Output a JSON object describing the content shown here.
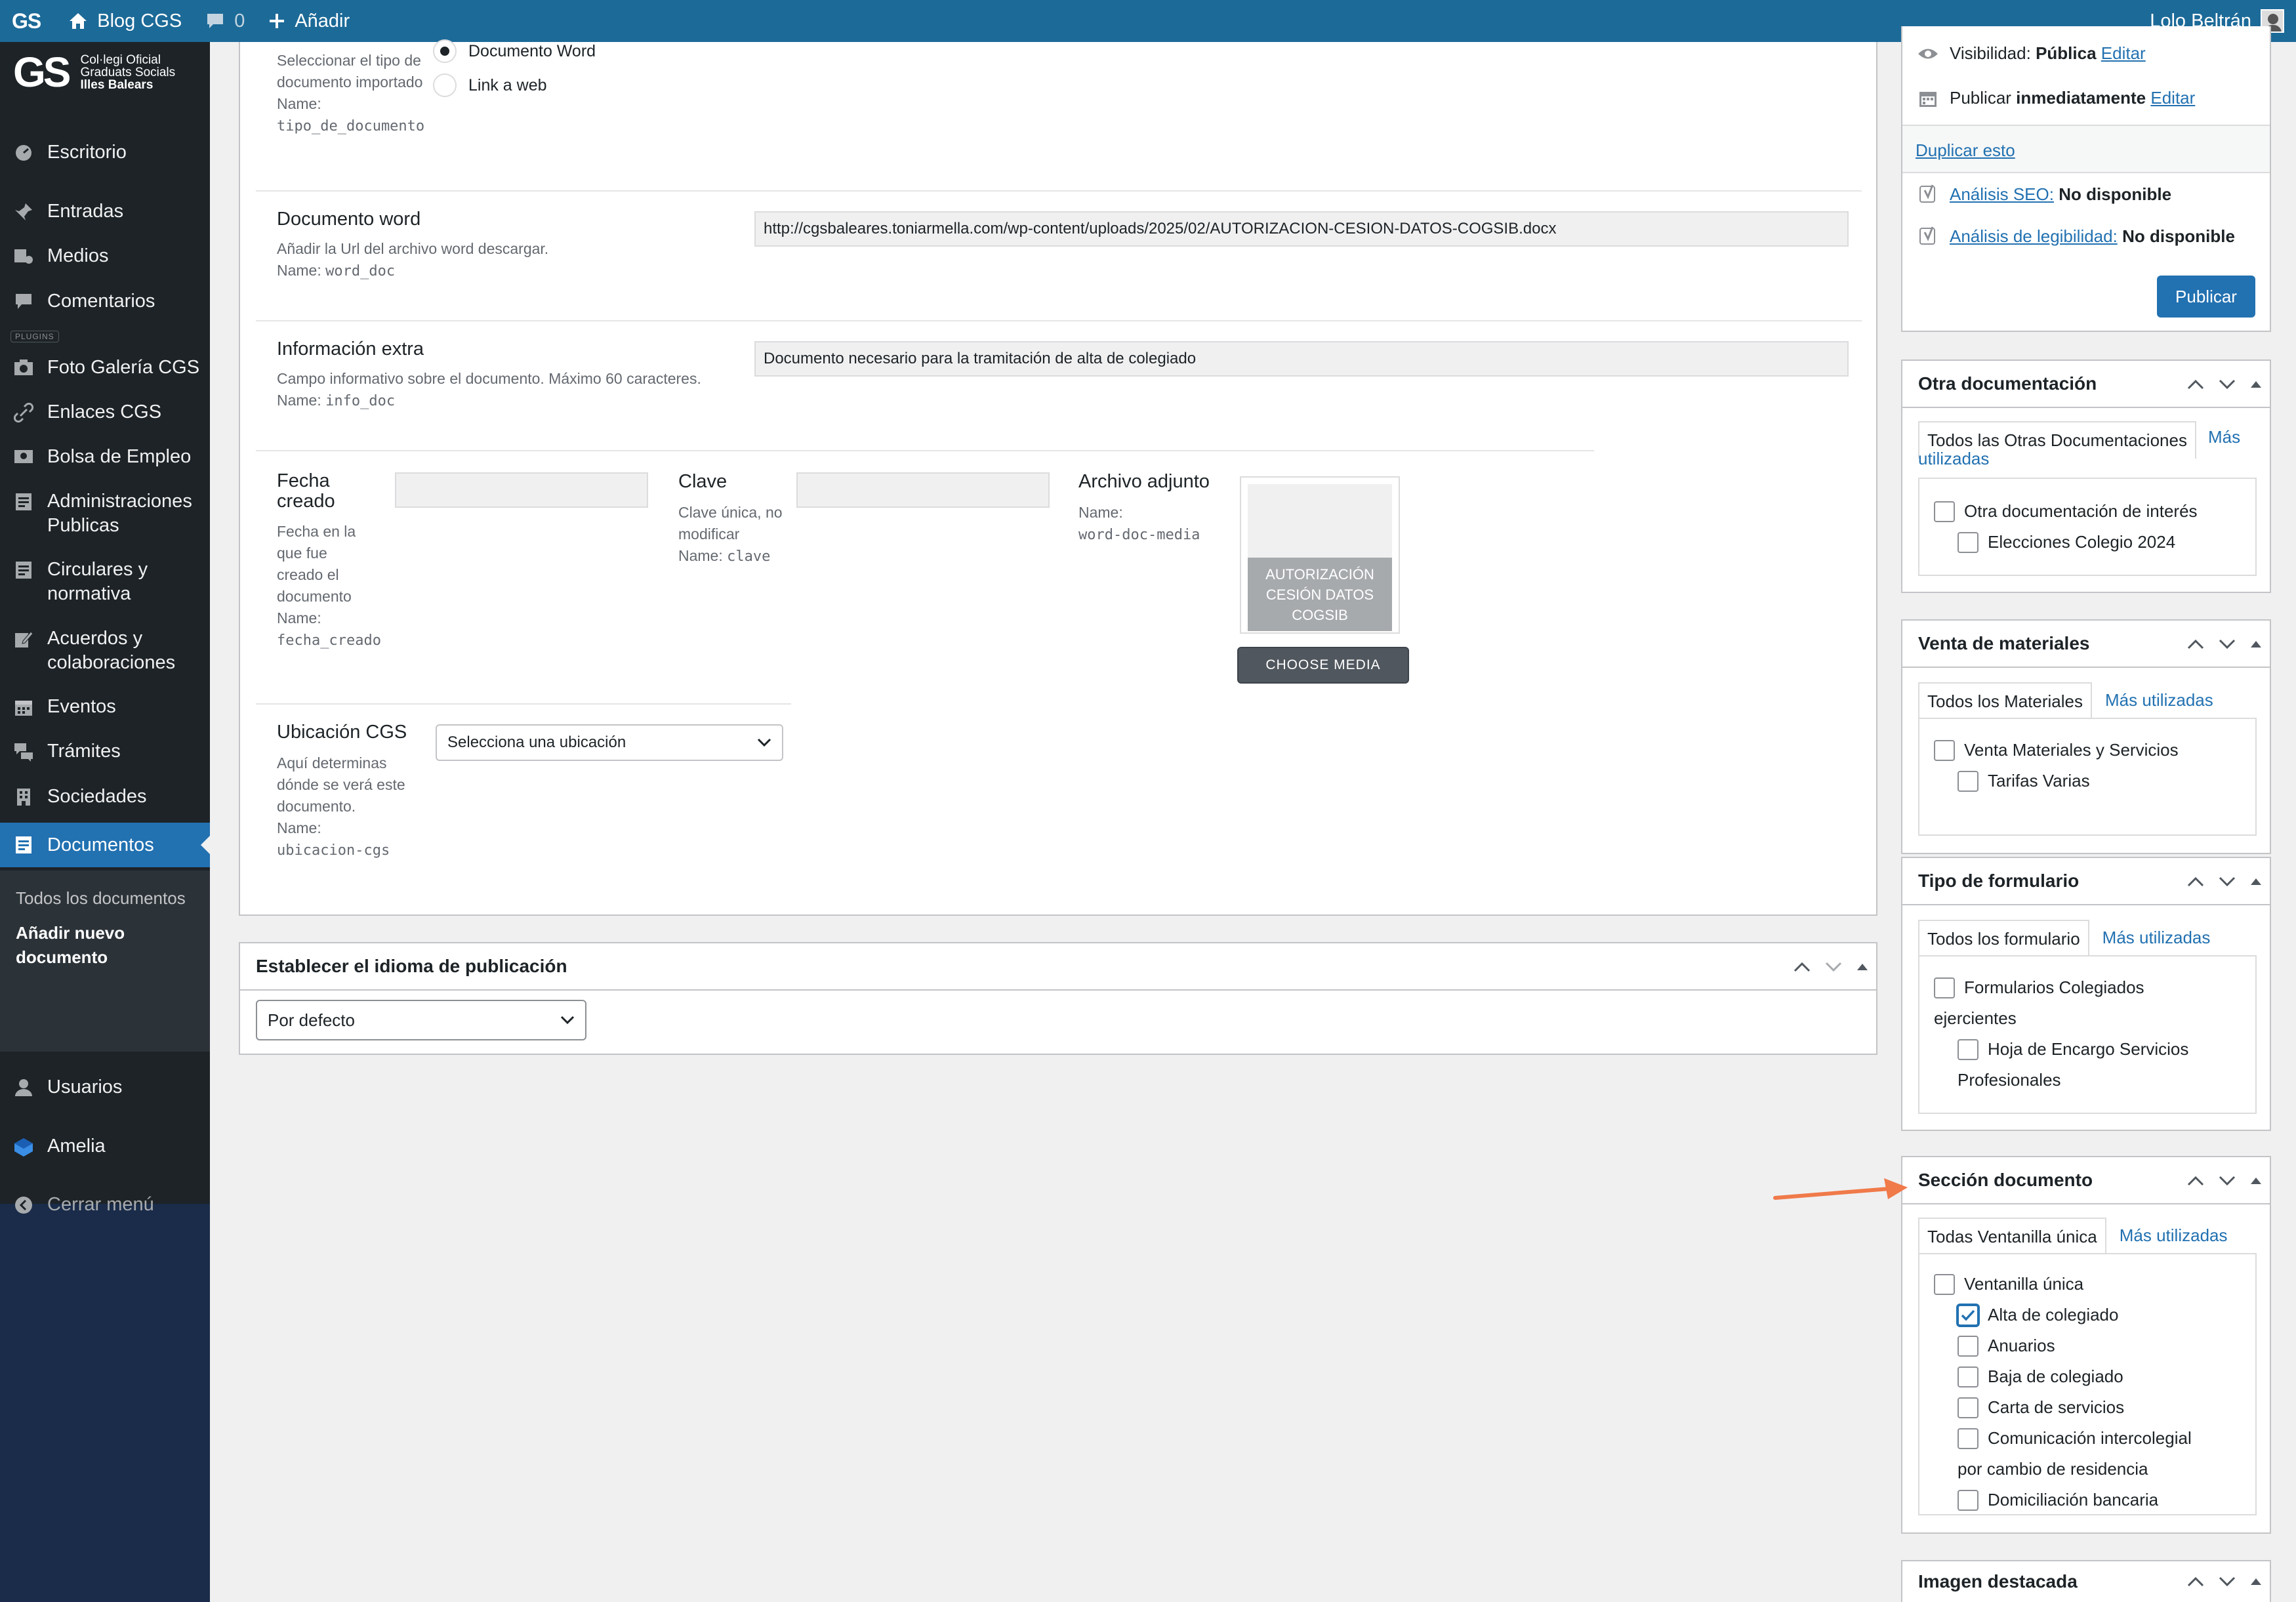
{
  "adminbar": {
    "logo": "GS",
    "site_name": "Blog CGS",
    "comments_count": "0",
    "add_new": "Añadir",
    "user_name": "Lolo Beltrán"
  },
  "brand": {
    "mark": "GS",
    "line1": "Col·legi Oficial",
    "line2": "Graduats Socials",
    "line3": "Illes Balears"
  },
  "sidebar": {
    "plugins_separator": "PLUGINS",
    "items": [
      {
        "label": "Escritorio"
      },
      {
        "label": "Entradas"
      },
      {
        "label": "Medios"
      },
      {
        "label": "Comentarios"
      },
      {
        "label": "Foto Galería CGS"
      },
      {
        "label": "Enlaces CGS"
      },
      {
        "label": "Bolsa de Empleo"
      },
      {
        "label": "Administraciones Publicas"
      },
      {
        "label": "Circulares y normativa"
      },
      {
        "label": "Acuerdos y colaboraciones"
      },
      {
        "label": "Eventos"
      },
      {
        "label": "Trámites"
      },
      {
        "label": "Sociedades"
      },
      {
        "label": "Documentos"
      },
      {
        "label": "Usuarios"
      },
      {
        "label": "Amelia"
      },
      {
        "label": "Cerrar menú"
      }
    ],
    "submenu": [
      {
        "label": "Todos los documentos"
      },
      {
        "label": "Añadir nuevo documento"
      }
    ]
  },
  "acf": {
    "tipo": {
      "desc": "Seleccionar el tipo de documento importado",
      "name_prefix": "Name:",
      "name": "tipo_de_documento",
      "options": [
        "Documento Word",
        "Link a web"
      ],
      "selected": "Documento Word"
    },
    "word_doc": {
      "label": "Documento word",
      "desc": "Añadir la Url del archivo word descargar.",
      "name_prefix": "Name:",
      "name": "word_doc",
      "value": "http://cgsbaleares.toniarmella.com/wp-content/uploads/2025/02/AUTORIZACION-CESION-DATOS-COGSIB.docx"
    },
    "info_doc": {
      "label": "Información extra",
      "desc": "Campo informativo sobre el documento. Máximo 60 caracteres.",
      "name_prefix": "Name:",
      "name": "info_doc",
      "value": "Documento necesario para la tramitación de alta de colegiado"
    },
    "fecha": {
      "label": "Fecha creado",
      "desc": "Fecha en la que fue creado el documento",
      "name_prefix": "Name:",
      "name": "fecha_creado",
      "value": ""
    },
    "clave": {
      "label": "Clave",
      "desc": "Clave única, no modificar",
      "name_prefix": "Name:",
      "name": "clave",
      "value": ""
    },
    "archivo": {
      "label": "Archivo adjunto",
      "name_prefix": "Name:",
      "name": "word-doc-media",
      "thumb_label": "AUTORIZACIÓN CESIÓN DATOS COGSIB",
      "button": "CHOOSE MEDIA"
    },
    "ubicacion": {
      "label": "Ubicación CGS",
      "desc": "Aquí determinas dónde se verá este documento.",
      "name_prefix": "Name:",
      "name": "ubicacion-cgs",
      "selected": "Selecciona una ubicación"
    }
  },
  "language_box": {
    "title": "Establecer el idioma de publicación",
    "selected": "Por defecto"
  },
  "publish": {
    "visibility_label": "Visibilidad:",
    "visibility_value": "Pública",
    "visibility_edit": "Editar",
    "publish_label": "Publicar",
    "publish_value": "inmediatamente",
    "publish_edit": "Editar",
    "duplicate": "Duplicar esto",
    "seo_label": "Análisis SEO:",
    "seo_value": "No disponible",
    "readability_label": "Análisis de legibilidad:",
    "readability_value": "No disponible",
    "button": "Publicar"
  },
  "otra_doc": {
    "title": "Otra documentación",
    "tab_all": "Todos las Otras Documentaciones",
    "tab_used_1": "Más",
    "tab_used_2": "utilizadas",
    "items": [
      {
        "label": "Otra documentación de interés",
        "checked": false
      },
      {
        "label": "Elecciones Colegio 2024",
        "checked": false
      }
    ]
  },
  "venta": {
    "title": "Venta de materiales",
    "tab_all": "Todos los Materiales",
    "tab_used": "Más utilizadas",
    "items": [
      {
        "label": "Venta Materiales y Servicios",
        "checked": false
      },
      {
        "label": "Tarifas Varias",
        "checked": false
      }
    ]
  },
  "tipo_form": {
    "title": "Tipo de formulario",
    "tab_all": "Todos los formulario",
    "tab_used": "Más utilizadas",
    "items": [
      {
        "label_1": "Formularios Colegiados",
        "label_2": "ejercientes",
        "checked": false
      },
      {
        "label_1": "Hoja de Encargo Servicios",
        "label_2": "Profesionales",
        "checked": false
      }
    ]
  },
  "seccion": {
    "title": "Sección documento",
    "tab_all": "Todas Ventanilla única",
    "tab_used": "Más utilizadas",
    "items": [
      {
        "label": "Ventanilla única",
        "checked": false
      },
      {
        "label": "Alta de colegiado",
        "checked": true
      },
      {
        "label": "Anuarios",
        "checked": false
      },
      {
        "label": "Baja de colegiado",
        "checked": false
      },
      {
        "label": "Carta de servicios",
        "checked": false
      },
      {
        "label_1": "Comunicación intercolegial",
        "label_2": "por cambio de residencia",
        "checked": false
      },
      {
        "label": "Domiciliación bancaria",
        "checked": false
      }
    ]
  },
  "imagen": {
    "title": "Imagen destacada"
  },
  "colors": {
    "adminbar": "#1c6a98",
    "menu_bg": "#1d2327",
    "accent": "#2271b1",
    "annotation_arrow": "#f07a4a"
  }
}
